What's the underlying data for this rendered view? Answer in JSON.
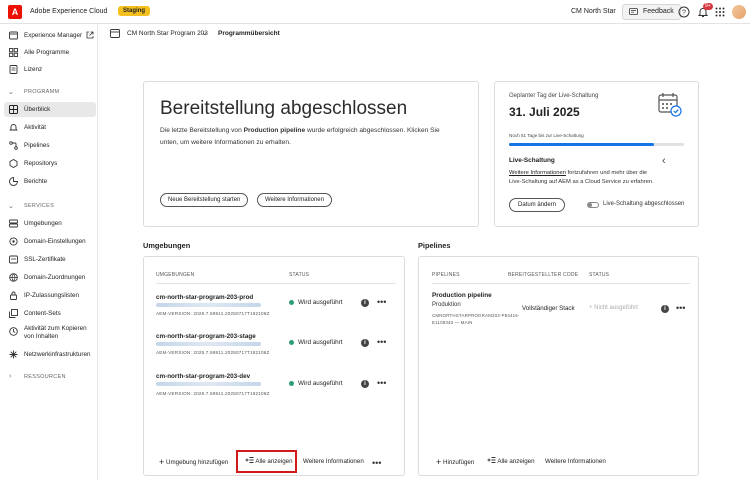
{
  "topbar": {
    "logo_letter": "A",
    "app_title": "Adobe Experience Cloud",
    "env_badge": "Staging",
    "org_name": "CM North Star",
    "feedback_label": "Feedback",
    "notification_count": "9+"
  },
  "sidebar": {
    "items_top": [
      {
        "label": "Experience Manager",
        "icon": "experience-manager-icon"
      },
      {
        "label": "Alle Programme",
        "icon": "programs-icon"
      },
      {
        "label": "Lizenz",
        "icon": "license-icon"
      }
    ],
    "section_program": "PROGRAMM",
    "items_program": [
      {
        "label": "Überblick",
        "icon": "overview-icon",
        "active": true
      },
      {
        "label": "Aktivität",
        "icon": "activity-icon"
      },
      {
        "label": "Pipelines",
        "icon": "pipelines-icon"
      },
      {
        "label": "Repositorys",
        "icon": "repositories-icon"
      },
      {
        "label": "Berichte",
        "icon": "reports-icon"
      }
    ],
    "section_services": "SERVICES",
    "items_services": [
      {
        "label": "Umgebungen",
        "icon": "environments-icon"
      },
      {
        "label": "Domain-Einstellungen",
        "icon": "domain-settings-icon"
      },
      {
        "label": "SSL-Zertifikate",
        "icon": "ssl-icon"
      },
      {
        "label": "Domain-Zuordnungen",
        "icon": "domain-mapping-icon"
      },
      {
        "label": "IP-Zulassungslisten",
        "icon": "ip-allowlist-icon"
      },
      {
        "label": "Content-Sets",
        "icon": "content-sets-icon"
      },
      {
        "label": "Aktivität zum Kopieren",
        "label2": "von Inhalten",
        "icon": "content-copy-icon"
      },
      {
        "label": "Netzwerkinfrastrukturen",
        "icon": "network-icon"
      }
    ],
    "section_resources": "RESSOURCEN"
  },
  "breadcrumb": {
    "program": "CM North Star Program 203",
    "page": "Programmübersicht"
  },
  "deployment": {
    "title": "Bereitstellung abgeschlossen",
    "desc_prefix": "Die letzte Bereitstellung von ",
    "desc_bold": "Production pipeline",
    "desc_suffix": " wurde erfolgreich abgeschlossen. Klicken Sie",
    "desc_line2": "unten, um weitere Informationen zu erhalten.",
    "btn_new": "Neue Bereitstellung starten",
    "btn_more": "Weitere Informationen"
  },
  "golive": {
    "label": "Geplanter Tag der Live-Schaltung",
    "date": "31. Juli 2025",
    "progress_text": "Noch 51 Tage bis zur Live-Schaltung",
    "progress": 0.83,
    "section_title": "Live-Schaltung",
    "link_text": "Weitere Informationen",
    "text_after_link": " fortzufahren und mehr über die",
    "text_line2": "Live-Schaltung auf AEM as a Cloud Service zu erfahren.",
    "btn_change": "Datum ändern",
    "toggle_label": "Live-Schaltung abgeschlossen"
  },
  "environments": {
    "heading": "Umgebungen",
    "col_env": "UMGEBUNGEN",
    "col_status": "STATUS",
    "rows": [
      {
        "name": "cm-north-star-program-203-prod",
        "version": "AEM-VERSION: 2025.7.59911.20250717T192106Z",
        "status": "Wird ausgeführt"
      },
      {
        "name": "cm-north-star-program-203-stage",
        "version": "AEM-VERSION: 2025.7.59911.20250717T192106Z",
        "status": "Wird ausgeführt"
      },
      {
        "name": "cm-north-star-program-203-dev",
        "version": "AEM-VERSION: 2025.7.59911.20250717T192106Z",
        "status": "Wird ausgeführt"
      }
    ],
    "btn_add": "Umgebung hinzufügen",
    "btn_all": "Alle anzeigen",
    "btn_more": "Weitere Informationen"
  },
  "pipelines": {
    "heading": "Pipelines",
    "col_pipelines": "PIPELINES",
    "col_code": "BEREITGESTELLTER CODE",
    "col_status": "STATUS",
    "row": {
      "name": "Production pipeline",
      "type": "Produktion",
      "repo_line1": "CMNORTHSTARPROGRAM203-P84416-",
      "repo_line2": "E1109340 — MAIN",
      "code": "Vollständiger Stack",
      "status": "Nicht ausgeführt"
    },
    "btn_add": "Hinzufügen",
    "btn_all": "Alle anzeigen",
    "btn_more": "Weitere Informationen"
  },
  "colors": {
    "accent": "#1473e6",
    "running": "#2d9d78",
    "highlight": "#d11a1a",
    "logo": "#eb1000",
    "staging": "#f4c01e"
  }
}
